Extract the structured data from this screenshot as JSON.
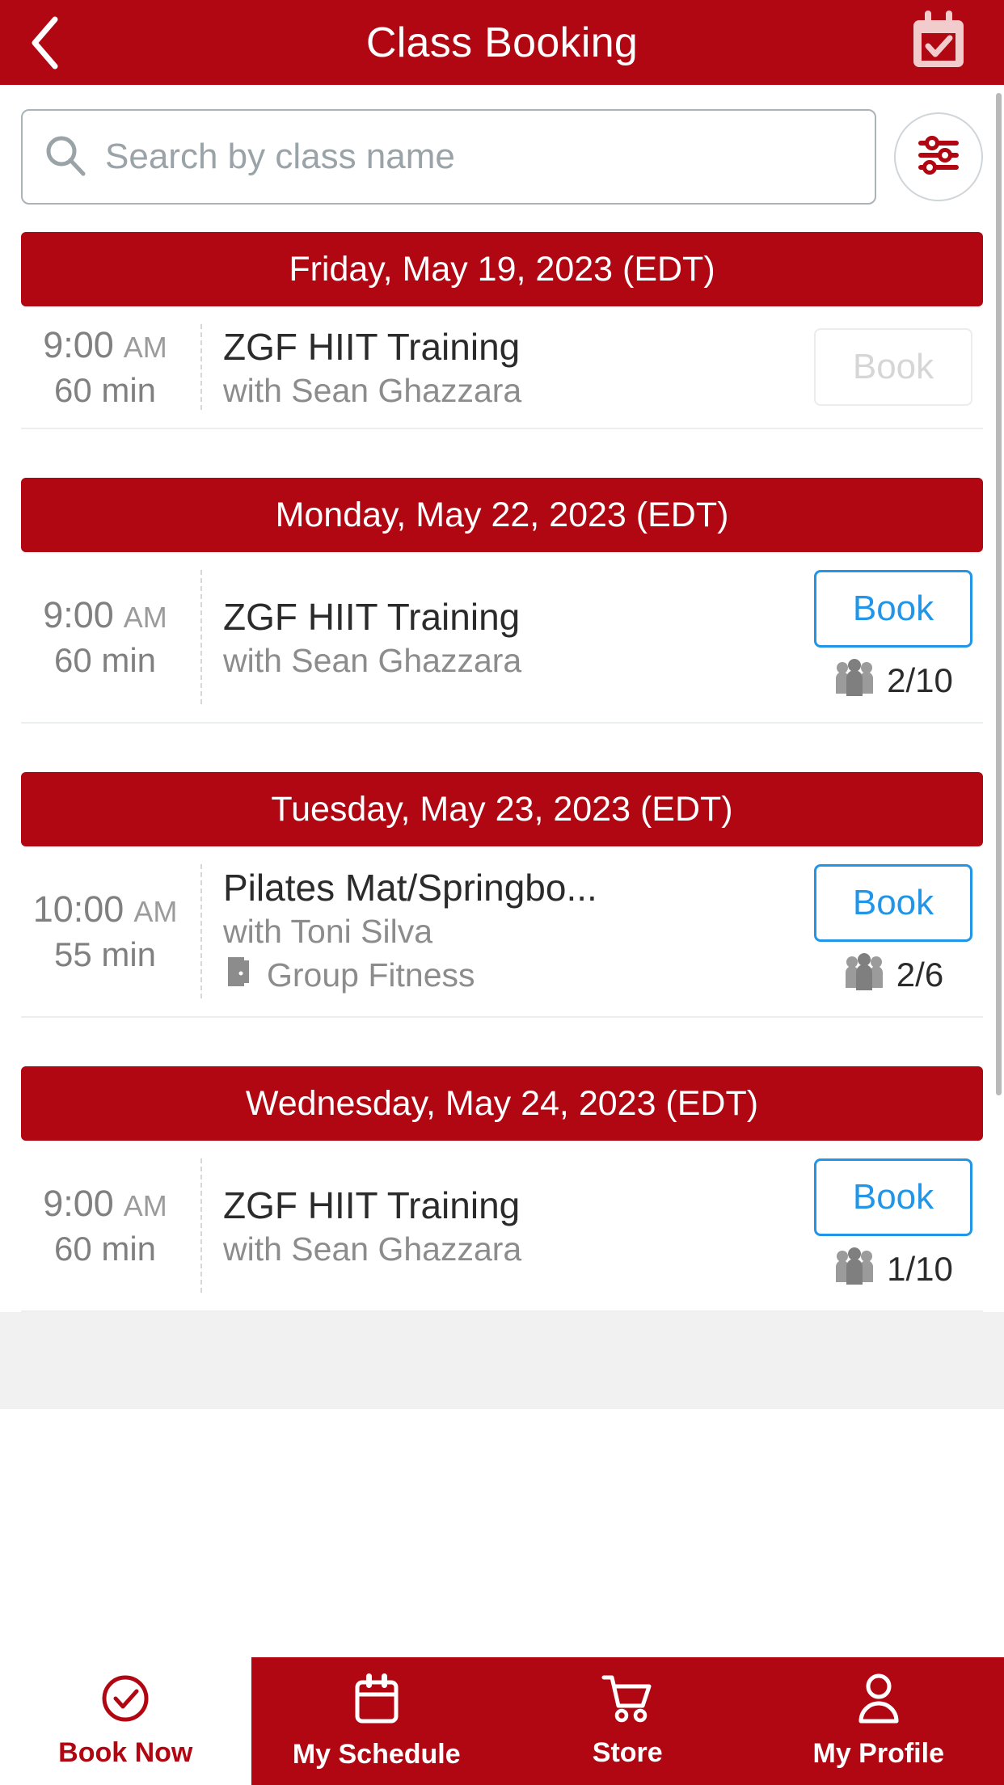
{
  "header": {
    "title": "Class Booking",
    "back_icon": "chevron-left-icon",
    "calendar_icon": "calendar-check-icon",
    "bg_color": "#b00712"
  },
  "search": {
    "placeholder": "Search by class name",
    "value": "",
    "search_icon": "search-icon",
    "filter_icon": "filter-sliders-icon"
  },
  "accent": {
    "brand_red": "#b00712",
    "link_blue": "#2196e8",
    "muted_grey": "#8c8c8c"
  },
  "groups": [
    {
      "date_label": "Friday, May 19, 2023 (EDT)",
      "classes": [
        {
          "time": "9:00",
          "ampm": "AM",
          "duration": "60 min",
          "name": "ZGF HIIT Training",
          "teacher": "with Sean Ghazzara",
          "room": "",
          "book_label": "Book",
          "book_enabled": false,
          "capacity": ""
        }
      ]
    },
    {
      "date_label": "Monday, May 22, 2023 (EDT)",
      "classes": [
        {
          "time": "9:00",
          "ampm": "AM",
          "duration": "60 min",
          "name": "ZGF HIIT Training",
          "teacher": "with Sean Ghazzara",
          "room": "",
          "book_label": "Book",
          "book_enabled": true,
          "capacity": "2/10"
        }
      ]
    },
    {
      "date_label": "Tuesday, May 23, 2023 (EDT)",
      "classes": [
        {
          "time": "10:00",
          "ampm": "AM",
          "duration": "55 min",
          "name": "Pilates Mat/Springbo...",
          "teacher": "with Toni Silva",
          "room": "Group Fitness",
          "book_label": "Book",
          "book_enabled": true,
          "capacity": "2/6"
        }
      ]
    },
    {
      "date_label": "Wednesday, May 24, 2023 (EDT)",
      "classes": [
        {
          "time": "9:00",
          "ampm": "AM",
          "duration": "60 min",
          "name": "ZGF HIIT Training",
          "teacher": "with Sean Ghazzara",
          "room": "",
          "book_label": "Book",
          "book_enabled": true,
          "capacity": "1/10"
        }
      ]
    }
  ],
  "tabbar": {
    "items": [
      {
        "label": "Book Now",
        "icon": "check-circle-icon",
        "active": true
      },
      {
        "label": "My Schedule",
        "icon": "calendar-icon",
        "active": false
      },
      {
        "label": "Store",
        "icon": "shopping-cart-icon",
        "active": false
      },
      {
        "label": "My Profile",
        "icon": "person-icon",
        "active": false
      }
    ]
  }
}
